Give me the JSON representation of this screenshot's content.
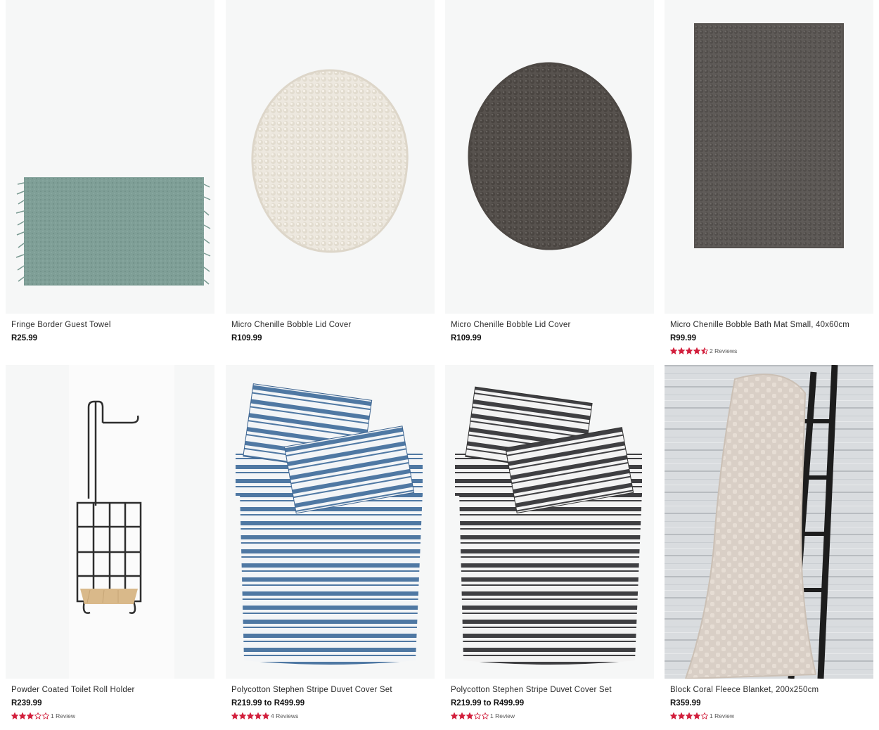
{
  "colors": {
    "star": "#d21f3c",
    "card_bg": "#f6f7f7"
  },
  "products": [
    {
      "name": "Fringe Border Guest Towel",
      "price": "R25.99",
      "image_icon": "green-towel-image"
    },
    {
      "name": "Micro Chenille Bobble Lid Cover",
      "price": "R109.99",
      "image_icon": "cream-lid-cover-image"
    },
    {
      "name": "Micro Chenille Bobble Lid Cover",
      "price": "R109.99",
      "image_icon": "charcoal-lid-cover-image"
    },
    {
      "name": "Micro Chenille Bobble Bath Mat Small, 40x60cm",
      "price": "R99.99",
      "rating": 4.5,
      "reviews": "2 Reviews",
      "image_icon": "charcoal-bath-mat-image"
    },
    {
      "name": "Powder Coated Toilet Roll Holder",
      "price": "R239.99",
      "rating": 3,
      "reviews": "1 Review",
      "image_icon": "toilet-roll-holder-image"
    },
    {
      "name": "Polycotton Stephen Stripe Duvet Cover Set",
      "price": "R219.99 to R499.99",
      "rating": 5,
      "reviews": "4 Reviews",
      "image_icon": "blue-stripe-duvet-image"
    },
    {
      "name": "Polycotton Stephen Stripe Duvet Cover Set",
      "price": "R219.99 to R499.99",
      "rating": 3,
      "reviews": "1 Review",
      "image_icon": "charcoal-stripe-duvet-image"
    },
    {
      "name": "Block Coral Fleece Blanket, 200x250cm",
      "price": "R359.99",
      "rating": 4,
      "reviews": "1 Review",
      "image_icon": "fleece-blanket-image"
    }
  ]
}
